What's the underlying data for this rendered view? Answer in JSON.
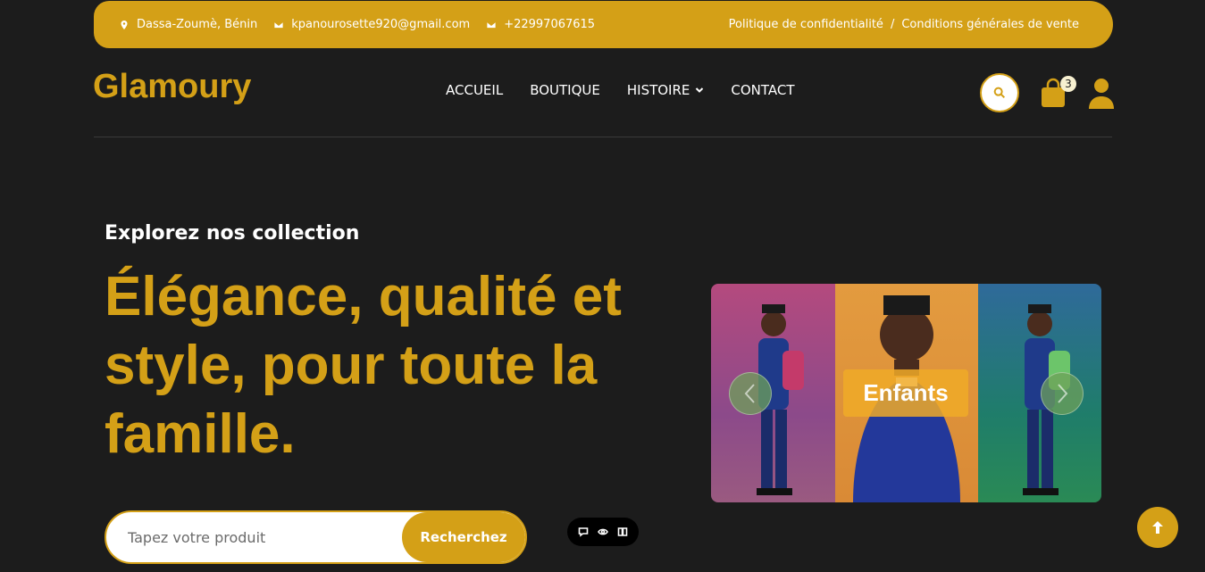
{
  "topbar": {
    "location": "Dassa-Zoumè, Bénin",
    "email": "kpanourosette920@gmail.com",
    "phone": "+22997067615",
    "privacy_link": "Politique de confidentialité",
    "separator": "/",
    "terms_link": "Conditions générales de vente",
    "icons": [
      "map-pin-icon",
      "envelope-icon",
      "envelope-icon"
    ]
  },
  "header": {
    "logo": "Glamoury",
    "nav": [
      {
        "label": "ACCUEIL"
      },
      {
        "label": "BOUTIQUE"
      },
      {
        "label": "HISTOIRE",
        "has_dropdown": true
      },
      {
        "label": "CONTACT"
      }
    ],
    "cart_count": "3",
    "icons": [
      "search-icon",
      "shopping-bag-icon",
      "user-icon"
    ]
  },
  "hero": {
    "subtitle": "Explorez nos collection",
    "headline": "Élégance, qualité et style, pour toute la famille.",
    "search": {
      "placeholder": "Tapez votre produit",
      "value": "",
      "button_label": "Recherchez"
    }
  },
  "carousel": {
    "slide_label": "Enfants",
    "icons": [
      "chevron-left-icon",
      "chevron-right-icon"
    ]
  },
  "mini_toolbar": {
    "icons": [
      "chat-icon",
      "eye-icon",
      "book-icon"
    ]
  },
  "back_to_top": {
    "icon": "arrow-up-icon"
  },
  "colors": {
    "accent": "#d4a017",
    "background": "#1c1c1c",
    "text": "#ffffff"
  }
}
